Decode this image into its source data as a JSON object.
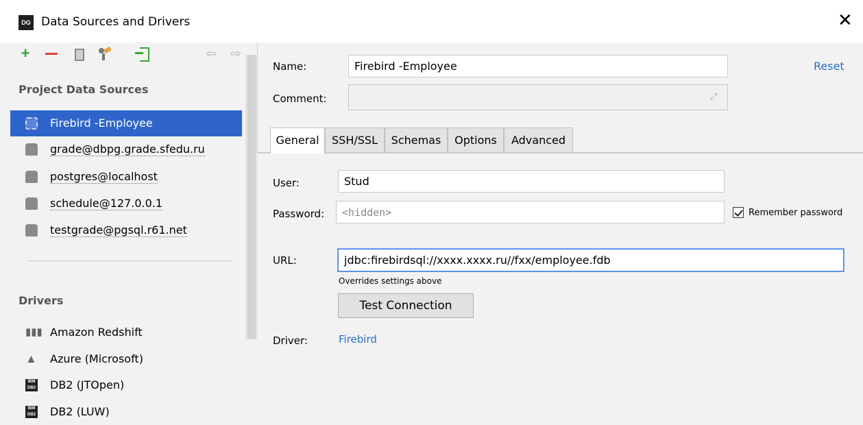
{
  "window": {
    "title": "Data Sources and Drivers",
    "logo_text": "DG"
  },
  "toolbar": {
    "icons": [
      "add-icon",
      "remove-icon",
      "copy-icon",
      "properties-icon",
      "import-icon",
      "back-icon",
      "forward-icon"
    ],
    "add_color": "#3aa33a",
    "remove_color": "#d9453d"
  },
  "sidebar": {
    "project_header": "Project Data Sources",
    "data_sources": [
      {
        "label": "Firebird -Employee",
        "selected": true
      },
      {
        "label": "grade@dbpg.grade.sfedu.ru"
      },
      {
        "label": "postgres@localhost"
      },
      {
        "label": "schedule@127.0.0.1"
      },
      {
        "label": "testgrade@pgsql.r61.net"
      }
    ],
    "drivers_header": "Drivers",
    "drivers": [
      {
        "label": "Amazon Redshift",
        "icon": "redshift-icon"
      },
      {
        "label": "Azure (Microsoft)",
        "icon": "azure-icon"
      },
      {
        "label": "DB2 (JTOpen)",
        "icon": "db2-icon"
      },
      {
        "label": "DB2 (LUW)",
        "icon": "db2-icon"
      }
    ],
    "selected_color": "#2f65ca"
  },
  "form": {
    "name_label": "Name:",
    "name_value": "Firebird -Employee",
    "reset_label": "Reset",
    "comment_label": "Comment:",
    "comment_value": "",
    "tabs": [
      "General",
      "SSH/SSL",
      "Schemas",
      "Options",
      "Advanced"
    ],
    "active_tab": "General",
    "user_label": "User:",
    "user_value": "Stud",
    "password_label": "Password:",
    "password_placeholder": "<hidden>",
    "remember_label": "Remember password",
    "remember_checked": true,
    "url_label": "URL:",
    "url_value": "jdbc:firebirdsql://xxxx.xxxx.ru//fxx/employee.fdb",
    "url_hint": "Overrides settings above",
    "test_button": "Test Connection",
    "driver_label": "Driver:",
    "driver_value": "Firebird"
  }
}
